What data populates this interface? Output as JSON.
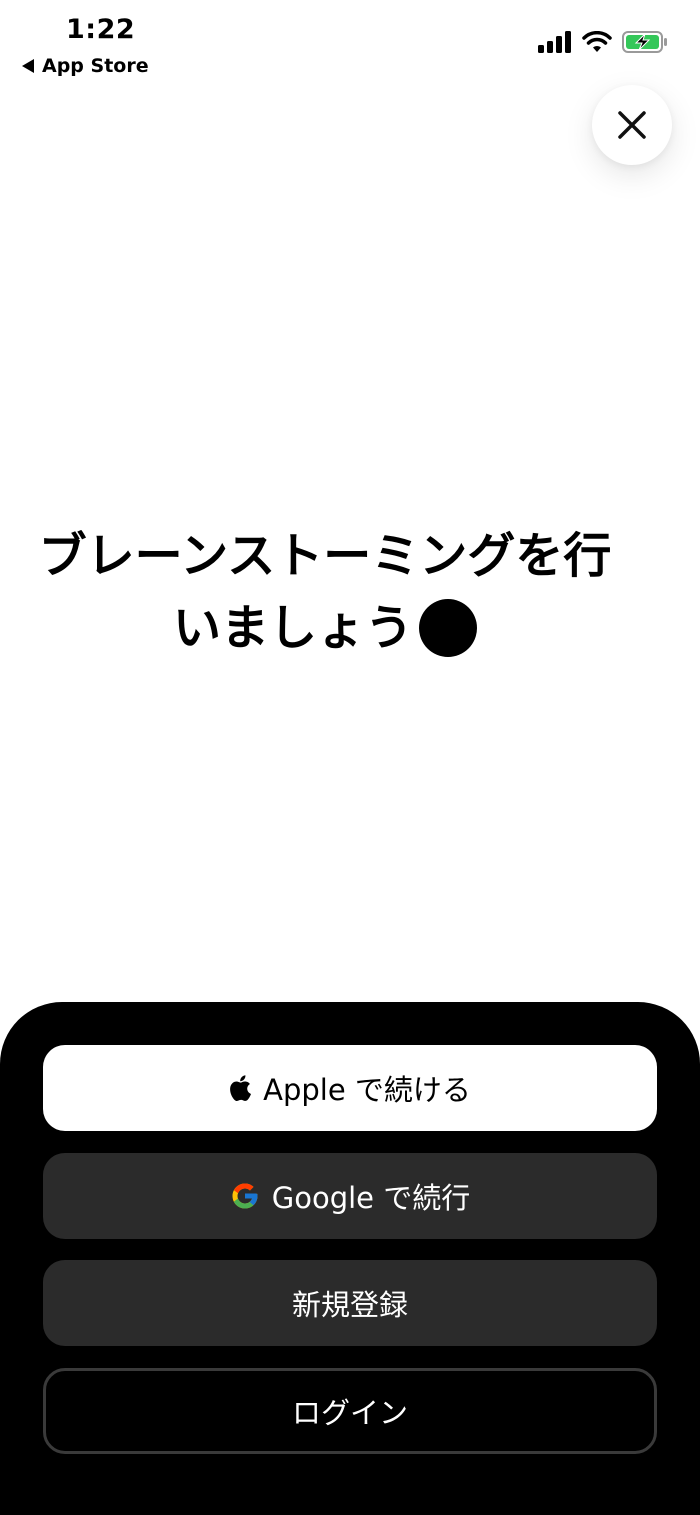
{
  "status_bar": {
    "time": "1:22",
    "back_label": "App Store",
    "icons": [
      "signal-icon",
      "wifi-icon",
      "battery-charging-icon"
    ],
    "battery_color": "#34c759"
  },
  "close": {
    "icon": "close-icon"
  },
  "headline": {
    "line1": "ブレーンストーミングを行",
    "line2": "いましょう"
  },
  "auth": {
    "apple_label": "Apple で続ける",
    "google_label": "Google で続行",
    "signup_label": "新規登録",
    "login_label": "ログイン"
  },
  "colors": {
    "sheet_background": "#000000",
    "dark_button": "#2b2b2b",
    "light_button": "#ffffff"
  }
}
